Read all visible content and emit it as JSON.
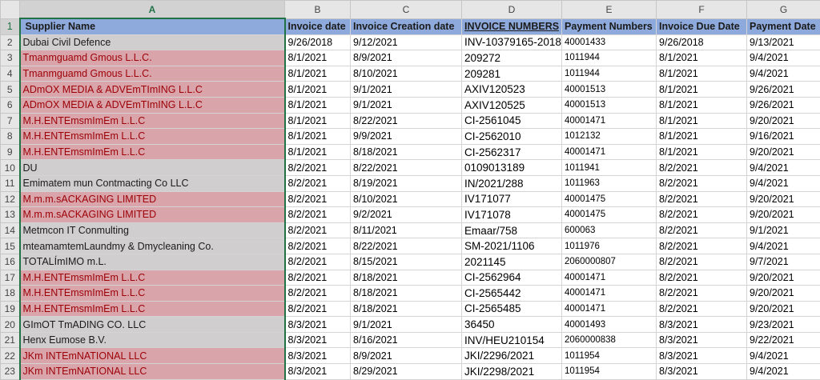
{
  "columns": [
    "A",
    "B",
    "C",
    "D",
    "E",
    "F",
    "G"
  ],
  "headers": [
    "Supplier Name",
    "Invoice date",
    "Invoice Creation date",
    "INVOICE NUMBERS",
    "Payment Numbers",
    "Invoice Due Date",
    "Payment Date"
  ],
  "rows": [
    {
      "n": "2",
      "s": "Dubai Civil Defence",
      "h": "g",
      "b": "9/26/2018",
      "c": "9/12/2021",
      "d": "INV-10379165-2018",
      "e": "40001433",
      "f": "9/26/2018",
      "g": "9/13/2021"
    },
    {
      "n": "3",
      "s": "Tmanmguamd Gmous L.L.C.",
      "h": "r",
      "b": "8/1/2021",
      "c": "8/9/2021",
      "d": "209272",
      "e": "1011944",
      "f": "8/1/2021",
      "g": "9/4/2021"
    },
    {
      "n": "4",
      "s": "Tmanmguamd Gmous L.L.C.",
      "h": "r",
      "b": "8/1/2021",
      "c": "8/10/2021",
      "d": "209281",
      "e": "1011944",
      "f": "8/1/2021",
      "g": "9/4/2021"
    },
    {
      "n": "5",
      "s": "ADmOX MEDIA & ADVEmTImING L.L.C",
      "h": "r",
      "b": "8/1/2021",
      "c": "9/1/2021",
      "d": "AXIV120523",
      "e": "40001513",
      "f": "8/1/2021",
      "g": "9/26/2021"
    },
    {
      "n": "6",
      "s": "ADmOX MEDIA & ADVEmTImING L.L.C",
      "h": "r",
      "b": "8/1/2021",
      "c": "9/1/2021",
      "d": "AXIV120525",
      "e": "40001513",
      "f": "8/1/2021",
      "g": "9/26/2021"
    },
    {
      "n": "7",
      "s": "M.H.ENTEmsmImEm L.L.C",
      "h": "r",
      "b": "8/1/2021",
      "c": "8/22/2021",
      "d": "CI-2561045",
      "e": "40001471",
      "f": "8/1/2021",
      "g": "9/20/2021"
    },
    {
      "n": "8",
      "s": "M.H.ENTEmsmImEm L.L.C",
      "h": "r",
      "b": "8/1/2021",
      "c": "9/9/2021",
      "d": "CI-2562010",
      "e": "1012132",
      "f": "8/1/2021",
      "g": "9/16/2021"
    },
    {
      "n": "9",
      "s": "M.H.ENTEmsmImEm L.L.C",
      "h": "r",
      "b": "8/1/2021",
      "c": "8/18/2021",
      "d": "CI-2562317",
      "e": "40001471",
      "f": "8/1/2021",
      "g": "9/20/2021"
    },
    {
      "n": "10",
      "s": "DU",
      "h": "g",
      "b": "8/2/2021",
      "c": "8/22/2021",
      "d": "0109013189",
      "e": "1011941",
      "f": "8/2/2021",
      "g": "9/4/2021"
    },
    {
      "n": "11",
      "s": "Emimatem mun Contmacting Co LLC",
      "h": "g",
      "b": "8/2/2021",
      "c": "8/19/2021",
      "d": "IN/2021/288",
      "e": "1011963",
      "f": "8/2/2021",
      "g": "9/4/2021"
    },
    {
      "n": "12",
      "s": "M.m.m.sACKAGING LIMITED",
      "h": "r",
      "b": "8/2/2021",
      "c": "8/10/2021",
      "d": "IV171077",
      "e": "40001475",
      "f": "8/2/2021",
      "g": "9/20/2021"
    },
    {
      "n": "13",
      "s": "M.m.m.sACKAGING LIMITED",
      "h": "r",
      "b": "8/2/2021",
      "c": "9/2/2021",
      "d": "IV171078",
      "e": "40001475",
      "f": "8/2/2021",
      "g": "9/20/2021"
    },
    {
      "n": "14",
      "s": "Metmcon IT Conmulting",
      "h": "g",
      "b": "8/2/2021",
      "c": "8/11/2021",
      "d": "Emaar/758",
      "e": "600063",
      "f": "8/2/2021",
      "g": "9/1/2021"
    },
    {
      "n": "15",
      "s": "mteamamtemLaundmy & Dmycleaning Co.",
      "h": "g",
      "b": "8/2/2021",
      "c": "8/22/2021",
      "d": "SM-2021/1106",
      "e": "1011976",
      "f": "8/2/2021",
      "g": "9/4/2021"
    },
    {
      "n": "16",
      "s": "TOTALÍmIMO m.L.",
      "h": "g",
      "b": "8/2/2021",
      "c": "8/15/2021",
      "d": "2021145",
      "e": "2060000807",
      "f": "8/2/2021",
      "g": "9/7/2021"
    },
    {
      "n": "17",
      "s": "M.H.ENTEmsmImEm L.L.C",
      "h": "r",
      "b": "8/2/2021",
      "c": "8/18/2021",
      "d": "CI-2562964",
      "e": "40001471",
      "f": "8/2/2021",
      "g": "9/20/2021"
    },
    {
      "n": "18",
      "s": "M.H.ENTEmsmImEm L.L.C",
      "h": "r",
      "b": "8/2/2021",
      "c": "8/18/2021",
      "d": "CI-2565442",
      "e": "40001471",
      "f": "8/2/2021",
      "g": "9/20/2021"
    },
    {
      "n": "19",
      "s": "M.H.ENTEmsmImEm L.L.C",
      "h": "r",
      "b": "8/2/2021",
      "c": "8/18/2021",
      "d": "CI-2565485",
      "e": "40001471",
      "f": "8/2/2021",
      "g": "9/20/2021"
    },
    {
      "n": "20",
      "s": "GImOT TmADING CO. LLC",
      "h": "g",
      "b": "8/3/2021",
      "c": "9/1/2021",
      "d": "36450",
      "e": "40001493",
      "f": "8/3/2021",
      "g": "9/23/2021"
    },
    {
      "n": "21",
      "s": "Henx Eumose B.V.",
      "h": "g",
      "b": "8/3/2021",
      "c": "8/16/2021",
      "d": "INV/HEU210154",
      "e": "2060000838",
      "f": "8/3/2021",
      "g": "9/22/2021"
    },
    {
      "n": "22",
      "s": "JKm INTEmNATIONAL LLC",
      "h": "r",
      "b": "8/3/2021",
      "c": "8/9/2021",
      "d": "JKI/2296/2021",
      "e": "1011954",
      "f": "8/3/2021",
      "g": "9/4/2021"
    },
    {
      "n": "23",
      "s": "JKm INTEmNATIONAL LLC",
      "h": "r",
      "b": "8/3/2021",
      "c": "8/29/2021",
      "d": "JKI/2298/2021",
      "e": "1011954",
      "f": "8/3/2021",
      "g": "9/4/2021"
    }
  ]
}
